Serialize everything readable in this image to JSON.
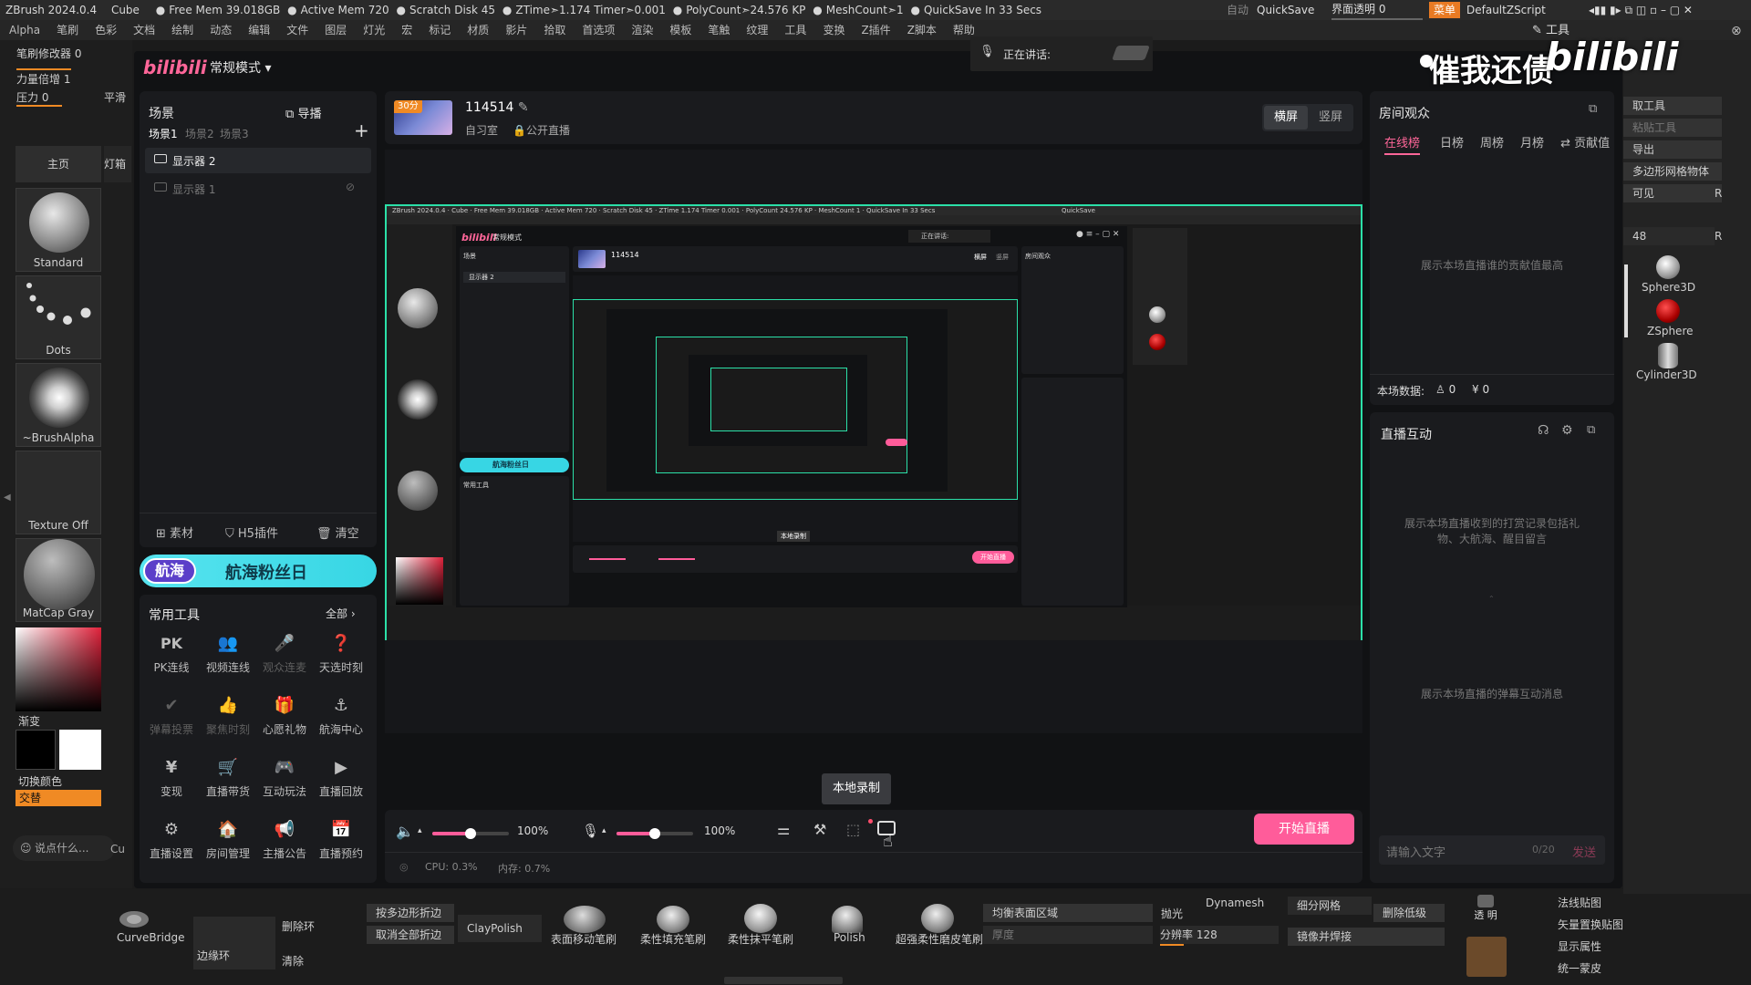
{
  "zbrush": {
    "titlebar": [
      "ZBrush 2024.0.4",
      "Cube",
      "Free Mem 39.018GB",
      "Active Mem 720",
      "Scratch Disk 45",
      "ZTime➣1.174 Timer➣0.001",
      "PolyCount➣24.576 KP",
      "MeshCount➣1",
      "QuickSave In 33 Secs"
    ],
    "auto_label": "自动",
    "quicksave": "QuickSave",
    "ui_opacity": "界面透明 0",
    "menu_btn": "菜单",
    "script": "DefaultZScript",
    "tools_label": "工具",
    "menus": [
      "Alpha",
      "笔刷",
      "色彩",
      "文档",
      "绘制",
      "动态",
      "编辑",
      "文件",
      "图层",
      "灯光",
      "宏",
      "标记",
      "材质",
      "影片",
      "拾取",
      "首选项",
      "渲染",
      "模板",
      "笔触",
      "纹理",
      "工具",
      "变换",
      "Z插件",
      "Z脚本",
      "帮助"
    ],
    "left_params": [
      "笔刷修改器 0",
      "力量倍增 1",
      "压力 0",
      "平滑"
    ],
    "left_tabs": [
      "主页",
      "灯箱"
    ],
    "brushes": [
      "Standard",
      "Dots",
      "~BrushAlpha",
      "Texture Off",
      "MatCap Gray"
    ],
    "gradient_label": "渐变",
    "switch_color": "切换颜色",
    "alternate": "交替",
    "say_something": "说点什么...",
    "cut_label": "Cu",
    "bottom": {
      "curvebridge": "CurveBridge",
      "delete_ring": "删除环",
      "edge_ring": "边缘环",
      "clear": "清除",
      "crease_by_poly": "按多边形折边",
      "uncrease_all": "取消全部折边",
      "claypolish": "ClayPolish",
      "surface_move": "表面移动笔刷",
      "soft_fill": "柔性填充笔刷",
      "soft_smooth": "柔性抹平笔刷",
      "polish": "Polish",
      "super_soft": "超强柔性磨皮笔刷",
      "balance_area": "均衡表面区域",
      "thickness": "厚度",
      "polish2": "抛光",
      "dynamesh": "Dynamesh",
      "resolution": "分辨率 128",
      "subdivide": "细分网格",
      "delete_lower": "删除低级",
      "mirror_weld": "镜像并焊接",
      "transparent": "透 明",
      "normal_map": "法线贴图",
      "vector_map": "矢量置换贴图",
      "display_props": "显示属性",
      "unify_skin": "统一蒙皮"
    },
    "right": {
      "get_tool": "取工具",
      "paste_tool": "粘贴工具",
      "export": "导出",
      "polymesh": "多边形网格物体",
      "visible": "可见",
      "r": "R",
      "value48": "48",
      "sphere3d": "Sphere3D",
      "zsphere": "ZSphere",
      "cylinder3d": "Cylinder3D"
    }
  },
  "app": {
    "logo": "bilibili",
    "mode": "常规模式",
    "mic_status": "正在讲话:",
    "watermark": "催我还债",
    "watermark_logo": "bilibili",
    "scene": {
      "title": "场景",
      "director": "导播",
      "tabs": [
        "场景1",
        "场景2",
        "场景3"
      ],
      "sources": [
        "显示器 2",
        "显示器 1"
      ]
    },
    "left_actions": [
      "素材",
      "H5插件",
      "清空"
    ],
    "banner": {
      "badge": "航海",
      "text": "航海粉丝日"
    },
    "tools": {
      "title": "常用工具",
      "all": "全部",
      "items": [
        {
          "label": "PK连线",
          "dim": false
        },
        {
          "label": "视频连线",
          "dim": false
        },
        {
          "label": "观众连麦",
          "dim": true
        },
        {
          "label": "天选时刻",
          "dim": false
        },
        {
          "label": "弹幕投票",
          "dim": true
        },
        {
          "label": "聚焦时刻",
          "dim": true
        },
        {
          "label": "心愿礼物",
          "dim": false
        },
        {
          "label": "航海中心",
          "dim": false
        },
        {
          "label": "变现",
          "dim": false
        },
        {
          "label": "直播带货",
          "dim": false
        },
        {
          "label": "互动玩法",
          "dim": false
        },
        {
          "label": "直播回放",
          "dim": false
        },
        {
          "label": "直播设置",
          "dim": false
        },
        {
          "label": "房间管理",
          "dim": false
        },
        {
          "label": "主播公告",
          "dim": false
        },
        {
          "label": "直播预约",
          "dim": false
        }
      ]
    },
    "room": {
      "badge": "30分",
      "id": "114514",
      "category": "自习室",
      "visibility": "公开直播",
      "orient_landscape": "横屏",
      "orient_portrait": "竖屏"
    },
    "controls": {
      "speaker_vol": "100%",
      "mic_vol": "100%",
      "speaker_level": 0.5,
      "mic_level": 0.5,
      "tooltip": "本地录制",
      "start_live": "开始直播",
      "cpu": "CPU: 0.3%",
      "mem": "内存: 0.7%"
    },
    "audience": {
      "title": "房间观众",
      "tabs": [
        "在线榜",
        "日榜",
        "周榜",
        "月榜",
        "贡献值"
      ],
      "empty": "展示本场直播谁的贡献值最高",
      "stats_label": "本场数据:",
      "viewers": "0",
      "income": "0"
    },
    "interaction": {
      "title": "直播互动",
      "gift_empty": "展示本场直播收到的打赏记录包括礼物、大航海、醒目留言",
      "danmaku_empty": "展示本场直播的弹幕互动消息",
      "input_placeholder": "请输入文字",
      "counter": "0/20",
      "send": "发送"
    }
  },
  "preview": {
    "title1": "ZBrush 2024.0.4 · Cube · Free Mem 39.018GB · Active Mem 720 · Scratch Disk 45 · ZTime 1.174 Timer 0.001 · PolyCount 24.576 KP · MeshCount 1 · QuickSave In 33 Secs",
    "quicksave": "QuickSave",
    "logo": "bilibili",
    "mode": "常规模式",
    "room_id": "114514",
    "landscape": "横屏",
    "portrait": "竖屏",
    "audience": "房间观众",
    "scene": "场景",
    "monitor2": "显示器 2",
    "banner": "航海粉丝日",
    "tooltip": "本地录制",
    "start_live": "开始直播",
    "tools": "常用工具",
    "speaking": "正在讲话:"
  },
  "colors": {
    "accent": "#ff6699",
    "start_btn": "#ff5c9a",
    "banner": "#37d6e4",
    "preview_border": "#2be0a8",
    "zb_orange": "#f08a24"
  }
}
